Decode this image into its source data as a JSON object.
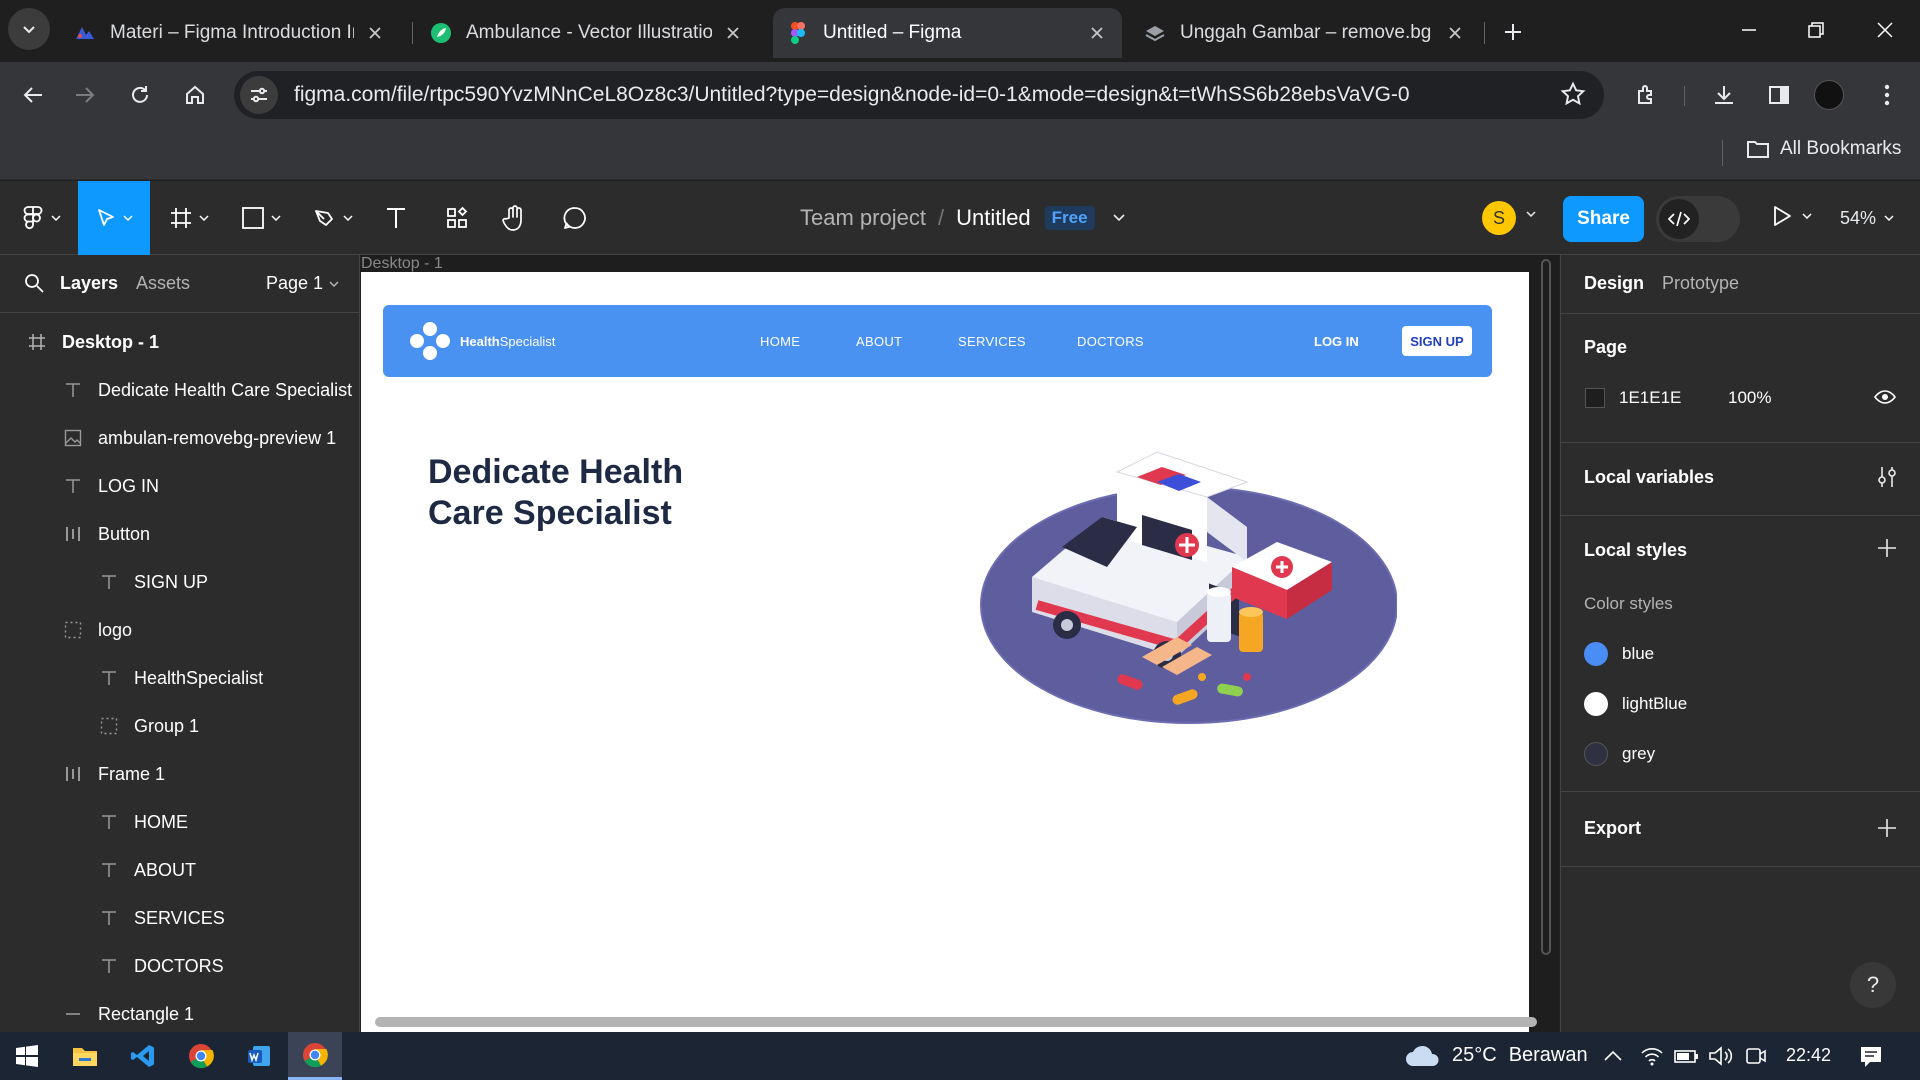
{
  "browser": {
    "tabs": [
      {
        "title": "Materi – Figma Introduction Int",
        "active": false
      },
      {
        "title": "Ambulance - Vector Illustration,",
        "active": false
      },
      {
        "title": "Untitled – Figma",
        "active": true
      },
      {
        "title": "Unggah Gambar – remove.bg",
        "active": false
      }
    ],
    "url": "figma.com/file/rtpc590YvzMNnCeL8Oz8c3/Untitled?type=design&node-id=0-1&mode=design&t=tWhSS6b28ebsVaVG-0",
    "bookmarks_label": "All Bookmarks"
  },
  "figma": {
    "breadcrumb": {
      "team": "Team project",
      "separator": "/",
      "file": "Untitled",
      "badge": "Free"
    },
    "avatar_initial": "S",
    "share_label": "Share",
    "zoom": "54%",
    "left_panel": {
      "tab_layers": "Layers",
      "tab_assets": "Assets",
      "page": "Page 1",
      "layers": [
        {
          "name": "Desktop - 1",
          "icon": "frame-icon",
          "indent": 0
        },
        {
          "name": "Dedicate Health Care Specialist",
          "icon": "text-icon",
          "indent": 1
        },
        {
          "name": "ambulan-removebg-preview 1",
          "icon": "image-icon",
          "indent": 1
        },
        {
          "name": "LOG IN",
          "icon": "text-icon",
          "indent": 1
        },
        {
          "name": "Button",
          "icon": "autolayout-icon",
          "indent": 1
        },
        {
          "name": "SIGN UP",
          "icon": "text-icon",
          "indent": 2
        },
        {
          "name": "logo",
          "icon": "group-icon",
          "indent": 1
        },
        {
          "name": "HealthSpecialist",
          "icon": "text-icon",
          "indent": 2
        },
        {
          "name": "Group 1",
          "icon": "group-icon",
          "indent": 2
        },
        {
          "name": "Frame 1",
          "icon": "autolayout-icon",
          "indent": 1
        },
        {
          "name": "HOME",
          "icon": "text-icon",
          "indent": 2
        },
        {
          "name": "ABOUT",
          "icon": "text-icon",
          "indent": 2
        },
        {
          "name": "SERVICES",
          "icon": "text-icon",
          "indent": 2
        },
        {
          "name": "DOCTORS",
          "icon": "text-icon",
          "indent": 2
        },
        {
          "name": "Rectangle 1",
          "icon": "line-icon",
          "indent": 1
        }
      ]
    },
    "canvas": {
      "frame_label": "Desktop - 1",
      "site": {
        "brand_bold": "Health",
        "brand_rest": "Specialist",
        "nav": [
          "HOME",
          "ABOUT",
          "SERVICES",
          "DOCTORS"
        ],
        "login": "LOG IN",
        "signup": "SIGN UP",
        "hero_line1": "Dedicate Health",
        "hero_line2": "Care Specialist",
        "nav_color": "#4a92f2"
      }
    },
    "right_panel": {
      "tab_design": "Design",
      "tab_prototype": "Prototype",
      "page_heading": "Page",
      "page_hex": "1E1E1E",
      "page_opacity": "100%",
      "local_variables": "Local variables",
      "local_styles": "Local styles",
      "color_styles_label": "Color styles",
      "color_styles": [
        {
          "name": "blue",
          "color": "#4a8ef5"
        },
        {
          "name": "lightBlue",
          "color": "#ffffff"
        },
        {
          "name": "grey",
          "color": "#2f3142"
        }
      ],
      "export": "Export",
      "help": "?"
    }
  },
  "taskbar": {
    "weather_temp": "25°C",
    "weather_desc": "Berawan",
    "time": "22:42"
  }
}
